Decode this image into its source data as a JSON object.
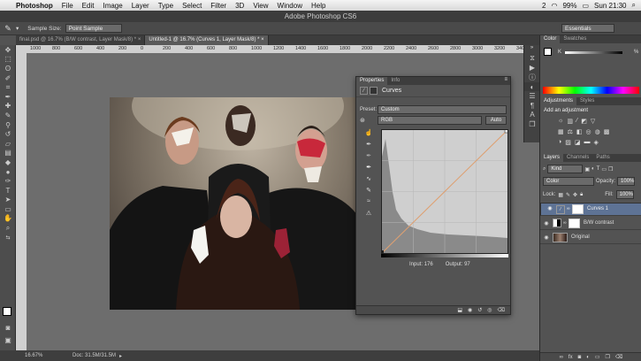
{
  "menubar": {
    "app": "Photoshop",
    "items": [
      "File",
      "Edit",
      "Image",
      "Layer",
      "Type",
      "Select",
      "Filter",
      "3D",
      "View",
      "Window",
      "Help"
    ],
    "status": {
      "notifications": "2",
      "battery": "99%",
      "clock": "Sun 21:30"
    }
  },
  "window_title": "Adobe Photoshop CS6",
  "options": {
    "sample_size_label": "Sample Size:",
    "sample_size_value": "Point Sample",
    "workspace": "Essentials"
  },
  "tabs": [
    {
      "label": "final.psd @ 16.7% (B/W contrast, Layer Mask/8) *",
      "active": false
    },
    {
      "label": "Untitled-1 @ 16.7% (Curves 1, Layer Mask/8) *",
      "active": true
    }
  ],
  "ruler_marks": [
    "1000",
    "800",
    "600",
    "400",
    "200",
    "0",
    "200",
    "400",
    "600",
    "800",
    "1000",
    "1200",
    "1400",
    "1600",
    "1800",
    "2000",
    "2200",
    "2400",
    "2600",
    "2800",
    "3000",
    "3200",
    "3400"
  ],
  "status": {
    "zoom": "16.67%",
    "doc": "Doc: 31.5M/31.5M"
  },
  "properties": {
    "tabs": [
      "Properties",
      "Info"
    ],
    "title": "Curves",
    "preset_label": "Preset:",
    "preset_value": "Custom",
    "channel": "RGB",
    "auto_label": "Auto",
    "input_label": "Input:",
    "input_value": "176",
    "output_label": "Output:",
    "output_value": "97"
  },
  "color_panel": {
    "tabs": [
      "Color",
      "Swatches"
    ],
    "channel": "K",
    "percent": "%"
  },
  "adjustments_panel": {
    "tabs": [
      "Adjustments",
      "Styles"
    ],
    "heading": "Add an adjustment"
  },
  "layers_panel": {
    "tabs": [
      "Layers",
      "Channels",
      "Paths"
    ],
    "kind": "Kind",
    "blend_mode": "Color",
    "opacity_label": "Opacity:",
    "opacity_value": "100%",
    "lock_label": "Lock:",
    "fill_label": "Fill:",
    "fill_value": "100%",
    "layers": [
      {
        "name": "Curves 1",
        "selected": true
      },
      {
        "name": "B/W contrast",
        "selected": false
      },
      {
        "name": "Original",
        "selected": false
      }
    ]
  },
  "colors": {
    "selection": "#5e7395",
    "curve_line": "#e0a070"
  }
}
